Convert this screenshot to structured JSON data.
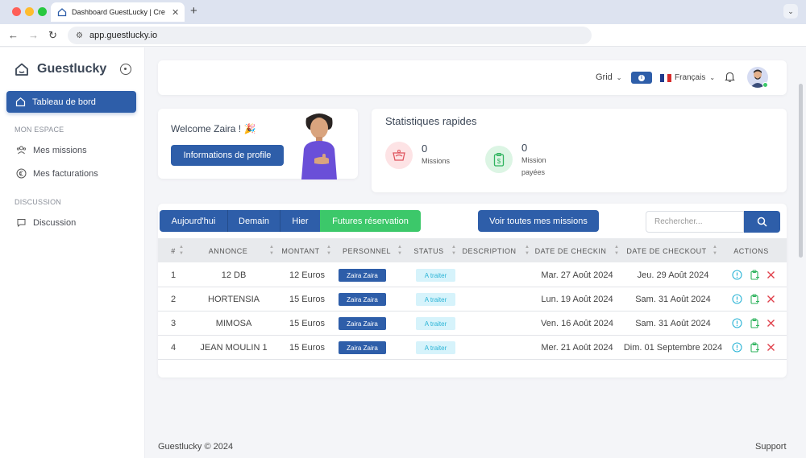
{
  "browser": {
    "tab_title": "Dashboard GuestLucky | Cre",
    "url": "app.guestlucky.io"
  },
  "sidebar": {
    "brand": "Guestlucky",
    "active_item": "Tableau de bord",
    "sections": [
      {
        "title": "MON ESPACE",
        "items": [
          "Mes missions",
          "Mes facturations"
        ]
      },
      {
        "title": "DISCUSSION",
        "items": [
          "Discussion"
        ]
      }
    ]
  },
  "header": {
    "grid_label": "Grid",
    "language": "Français",
    "colors": {
      "primary": "#2e5ea9",
      "success": "#3cc86a",
      "status": "#2bb4d6"
    }
  },
  "welcome": {
    "greeting": "Welcome Zaira ! 🎉",
    "profile_button": "Informations de profile"
  },
  "stats": {
    "title": "Statistiques rapides",
    "missions_value": "0",
    "missions_label": "Missions",
    "paid_value": "0",
    "paid_label_line1": "Mission",
    "paid_label_line2": "payées"
  },
  "filters": {
    "today": "Aujourd'hui",
    "tomorrow": "Demain",
    "yesterday": "Hier",
    "future": "Futures réservation",
    "see_all": "Voir toutes mes missions",
    "search_placeholder": "Rechercher..."
  },
  "table": {
    "columns": [
      "#",
      "ANNONCE",
      "MONTANT",
      "PERSONNEL",
      "STATUS",
      "DESCRIPTION",
      "DATE DE CHECKIN",
      "DATE DE CHECKOUT",
      "ACTIONS"
    ],
    "rows": [
      {
        "num": "1",
        "annonce": "12 DB",
        "montant": "12 Euros",
        "personnel": "Zaira Zaira",
        "status": "A traiter",
        "description": "",
        "checkin": "Mar. 27 Août 2024",
        "checkout": "Jeu. 29 Août 2024"
      },
      {
        "num": "2",
        "annonce": "HORTENSIA",
        "montant": "15 Euros",
        "personnel": "Zaira Zaira",
        "status": "A traiter",
        "description": "",
        "checkin": "Lun. 19 Août 2024",
        "checkout": "Sam. 31 Août 2024"
      },
      {
        "num": "3",
        "annonce": "MIMOSA",
        "montant": "15 Euros",
        "personnel": "Zaira Zaira",
        "status": "A traiter",
        "description": "",
        "checkin": "Ven. 16 Août 2024",
        "checkout": "Sam. 31 Août 2024"
      },
      {
        "num": "4",
        "annonce": "JEAN MOULIN 1",
        "montant": "15 Euros",
        "personnel": "Zaira Zaira",
        "status": "A traiter",
        "description": "",
        "checkin": "Mer. 21 Août 2024",
        "checkout": "Dim. 01 Septembre 2024"
      }
    ]
  },
  "footer": {
    "copyright": "Guestlucky © 2024",
    "support": "Support"
  }
}
